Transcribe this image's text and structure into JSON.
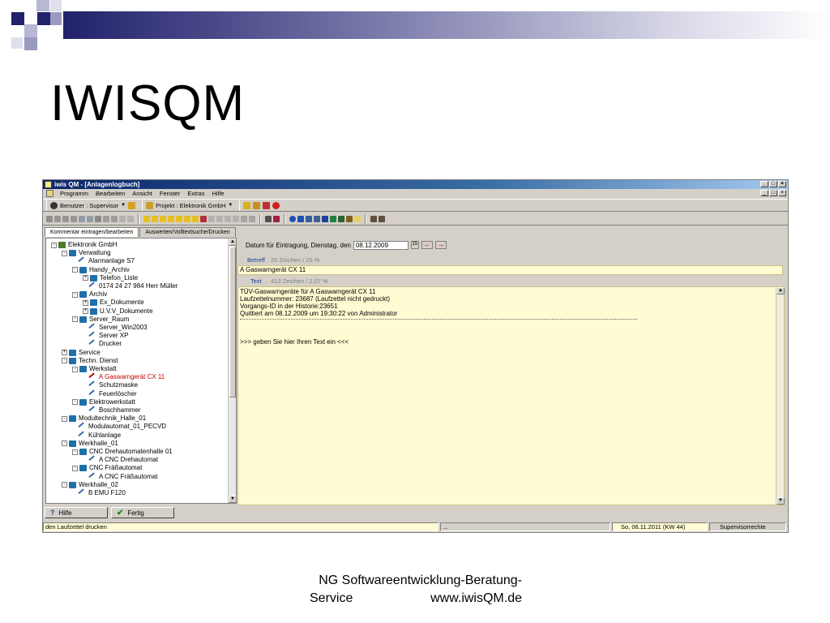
{
  "slide": {
    "title": "IWISQM",
    "footer_line1": "NG Softwareentwicklung-Beratung-",
    "footer_line2_left": "Service",
    "footer_line2_right": "www.iwisQM.de",
    "colors": {
      "accent_dark": "#22226b",
      "accent_mid": "#8a8ab8"
    }
  },
  "window": {
    "title": "iwis QM - [Anlagenlogbuch]",
    "controls": [
      "_",
      "□",
      "×"
    ]
  },
  "menu": [
    "Programm",
    "Bearbeiten",
    "Ansicht",
    "Fenster",
    "Extras",
    "Hilfe"
  ],
  "toolbar": {
    "user_label": "Benutzer : Supervisor",
    "project_label": "Projekt : Elektronik GmbH"
  },
  "tabs": [
    {
      "label": "Kommentar eintragen/bearbeiten",
      "active": true
    },
    {
      "label": "Auswerten/Volltextsuche/Drucken",
      "active": false
    }
  ],
  "tree": [
    {
      "label": "Elektronik GmbH",
      "exp": "-",
      "icon": "root"
    },
    {
      "label": "Verwaltung",
      "exp": "-",
      "icon": "folder"
    },
    {
      "label": "Alarmanlage S7",
      "exp": "",
      "icon": "tool"
    },
    {
      "label": "Handy_Archiv",
      "exp": "-",
      "icon": "folder"
    },
    {
      "label": "Telefon_Liste",
      "exp": "+",
      "icon": "folder"
    },
    {
      "label": "0174 24 27 984 Herr Müller",
      "exp": "",
      "icon": "tool"
    },
    {
      "label": "Archiv",
      "exp": "-",
      "icon": "folder"
    },
    {
      "label": "Ex_Dokumente",
      "exp": "+",
      "icon": "folder"
    },
    {
      "label": "U.V.V_Dokumente",
      "exp": "+",
      "icon": "folder"
    },
    {
      "label": "Server_Raum",
      "exp": "-",
      "icon": "folder"
    },
    {
      "label": "Server_Win2003",
      "exp": "",
      "icon": "tool"
    },
    {
      "label": "Server XP",
      "exp": "",
      "icon": "tool"
    },
    {
      "label": "Drucker",
      "exp": "",
      "icon": "tool"
    },
    {
      "label": "Service",
      "exp": "+",
      "icon": "folder"
    },
    {
      "label": "Techn. Dienst",
      "exp": "-",
      "icon": "folder"
    },
    {
      "label": "Werkstatt",
      "exp": "-",
      "icon": "folder"
    },
    {
      "label": "A Gaswarngerät CX 11",
      "exp": "",
      "icon": "tool",
      "selected": true
    },
    {
      "label": "Schutzmaske",
      "exp": "",
      "icon": "tool"
    },
    {
      "label": "Feuerlöscher",
      "exp": "",
      "icon": "tool"
    },
    {
      "label": "Elektrowerkstatt",
      "exp": "-",
      "icon": "folder"
    },
    {
      "label": "Boschhammer",
      "exp": "",
      "icon": "tool"
    },
    {
      "label": "Modultechnik_Halle_01",
      "exp": "-",
      "icon": "folder"
    },
    {
      "label": "Modulautomat_01_PECVD",
      "exp": "",
      "icon": "tool"
    },
    {
      "label": "Kühlanlage",
      "exp": "",
      "icon": "tool"
    },
    {
      "label": "Werkhalle_01",
      "exp": "-",
      "icon": "folder"
    },
    {
      "label": "CNC Drehautomatenhalle 01",
      "exp": "-",
      "icon": "folder"
    },
    {
      "label": "A CNC Drehautomat",
      "exp": "",
      "icon": "tool"
    },
    {
      "label": "CNC Fräßautomat",
      "exp": "-",
      "icon": "folder"
    },
    {
      "label": "A CNC Fräßautomat",
      "exp": "",
      "icon": "tool"
    },
    {
      "label": "Werkhalle_02",
      "exp": "-",
      "icon": "folder"
    },
    {
      "label": "B EMU F120",
      "exp": "",
      "icon": "tool"
    }
  ],
  "entry": {
    "date_label": "Datum für Eintragung, Dienstag, den",
    "date_value": "08.12.2009",
    "cal_btn": "15",
    "betreff_label": "Betreff",
    "betreff_count": "20 Zeichen / 25 %",
    "betreff_value": "A Gaswarngerät CX 11",
    "text_label": "Text",
    "text_count": "413 Zeichen / 2,07 %",
    "text_lines": [
      "TÜV-Gaswarngeräte für A Gaswarngerät CX 11",
      "Laufzettelnummer: 23687 (Laufzettel nicht gedruckt)",
      "Vorgangs-ID in der Historie:23651",
      "Quittiert am 08.12.2009 um 19:30:22 von Administrator"
    ],
    "prompt_line": ">>> geben Sie hier Ihren Text ein <<<"
  },
  "buttons": {
    "help": "Hilfe",
    "done": "Fertig"
  },
  "status": {
    "hint": "den Laufzettel drucken",
    "dots": "...",
    "date": "So, 06.11.2011 (KW 44)",
    "rights": "Supervisorrechte"
  }
}
